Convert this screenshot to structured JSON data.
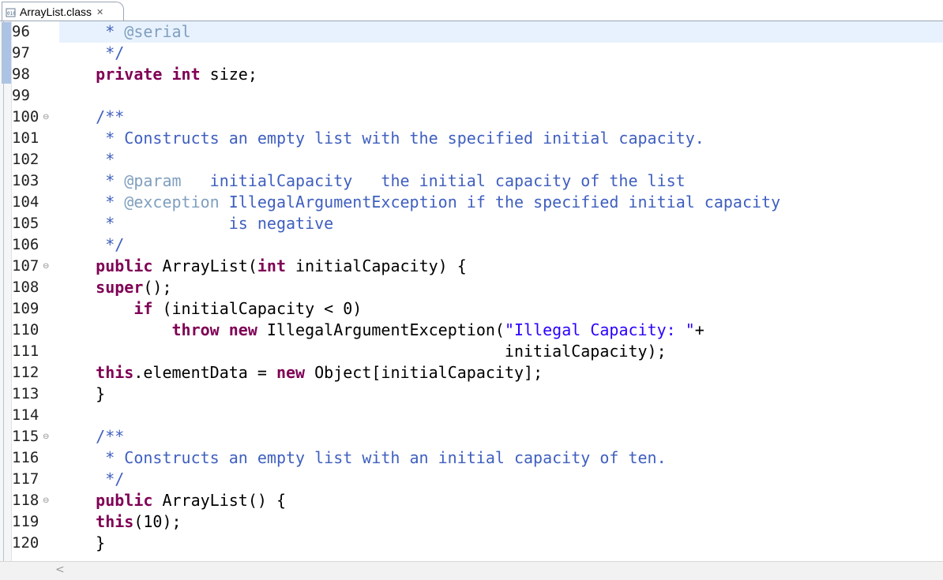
{
  "tab": {
    "title": "ArrayList.class",
    "icon": "class-file-icon",
    "close": "✕"
  },
  "lines": [
    {
      "n": "96",
      "fold": "",
      "tokens": [
        [
          "jd",
          "     * "
        ],
        [
          "tag",
          "@serial"
        ]
      ],
      "highlight": true
    },
    {
      "n": "97",
      "fold": "",
      "tokens": [
        [
          "jd",
          "     */"
        ]
      ]
    },
    {
      "n": "98",
      "fold": "",
      "tokens": [
        [
          "kw",
          "    private"
        ],
        [
          "plain",
          " "
        ],
        [
          "kw",
          "int"
        ],
        [
          "plain",
          " size;"
        ]
      ]
    },
    {
      "n": "99",
      "fold": "",
      "tokens": []
    },
    {
      "n": "100",
      "fold": "⊖",
      "tokens": [
        [
          "jd",
          "    /**"
        ]
      ]
    },
    {
      "n": "101",
      "fold": "",
      "tokens": [
        [
          "jd",
          "     * Constructs an empty list with the specified initial capacity."
        ]
      ]
    },
    {
      "n": "102",
      "fold": "",
      "tokens": [
        [
          "jd",
          "     *"
        ]
      ]
    },
    {
      "n": "103",
      "fold": "",
      "tokens": [
        [
          "jd",
          "     * "
        ],
        [
          "tag",
          "@param"
        ],
        [
          "jd",
          "   initialCapacity   the initial capacity of the list"
        ]
      ]
    },
    {
      "n": "104",
      "fold": "",
      "tokens": [
        [
          "jd",
          "     * "
        ],
        [
          "tag",
          "@exception"
        ],
        [
          "jd",
          " IllegalArgumentException if the specified initial capacity"
        ]
      ]
    },
    {
      "n": "105",
      "fold": "",
      "tokens": [
        [
          "jd",
          "     *            is negative"
        ]
      ]
    },
    {
      "n": "106",
      "fold": "",
      "tokens": [
        [
          "jd",
          "     */"
        ]
      ]
    },
    {
      "n": "107",
      "fold": "⊖",
      "tokens": [
        [
          "kw",
          "    public"
        ],
        [
          "plain",
          " ArrayList("
        ],
        [
          "kw",
          "int"
        ],
        [
          "plain",
          " initialCapacity) {"
        ]
      ]
    },
    {
      "n": "108",
      "fold": "",
      "tokens": [
        [
          "kw",
          "    super"
        ],
        [
          "plain",
          "();"
        ]
      ]
    },
    {
      "n": "109",
      "fold": "",
      "tokens": [
        [
          "plain",
          "        "
        ],
        [
          "kw",
          "if"
        ],
        [
          "plain",
          " (initialCapacity < 0)"
        ]
      ]
    },
    {
      "n": "110",
      "fold": "",
      "tokens": [
        [
          "plain",
          "            "
        ],
        [
          "kw",
          "throw"
        ],
        [
          "plain",
          " "
        ],
        [
          "kw",
          "new"
        ],
        [
          "plain",
          " IllegalArgumentException("
        ],
        [
          "str",
          "\"Illegal Capacity: \""
        ],
        [
          "plain",
          "+"
        ]
      ]
    },
    {
      "n": "111",
      "fold": "",
      "tokens": [
        [
          "plain",
          "                                               initialCapacity);"
        ]
      ]
    },
    {
      "n": "112",
      "fold": "",
      "tokens": [
        [
          "kw",
          "    this"
        ],
        [
          "plain",
          ".elementData = "
        ],
        [
          "kw",
          "new"
        ],
        [
          "plain",
          " Object[initialCapacity];"
        ]
      ]
    },
    {
      "n": "113",
      "fold": "",
      "tokens": [
        [
          "plain",
          "    }"
        ]
      ]
    },
    {
      "n": "114",
      "fold": "",
      "tokens": []
    },
    {
      "n": "115",
      "fold": "⊖",
      "tokens": [
        [
          "jd",
          "    /**"
        ]
      ]
    },
    {
      "n": "116",
      "fold": "",
      "tokens": [
        [
          "jd",
          "     * Constructs an empty list with an initial capacity of ten."
        ]
      ]
    },
    {
      "n": "117",
      "fold": "",
      "tokens": [
        [
          "jd",
          "     */"
        ]
      ]
    },
    {
      "n": "118",
      "fold": "⊖",
      "tokens": [
        [
          "kw",
          "    public"
        ],
        [
          "plain",
          " ArrayList() {"
        ]
      ]
    },
    {
      "n": "119",
      "fold": "",
      "tokens": [
        [
          "kw",
          "    this"
        ],
        [
          "plain",
          "(10);"
        ]
      ]
    },
    {
      "n": "120",
      "fold": "",
      "tokens": [
        [
          "plain",
          "    }"
        ]
      ]
    }
  ],
  "scrollbar": {
    "left_arrow": "<"
  }
}
